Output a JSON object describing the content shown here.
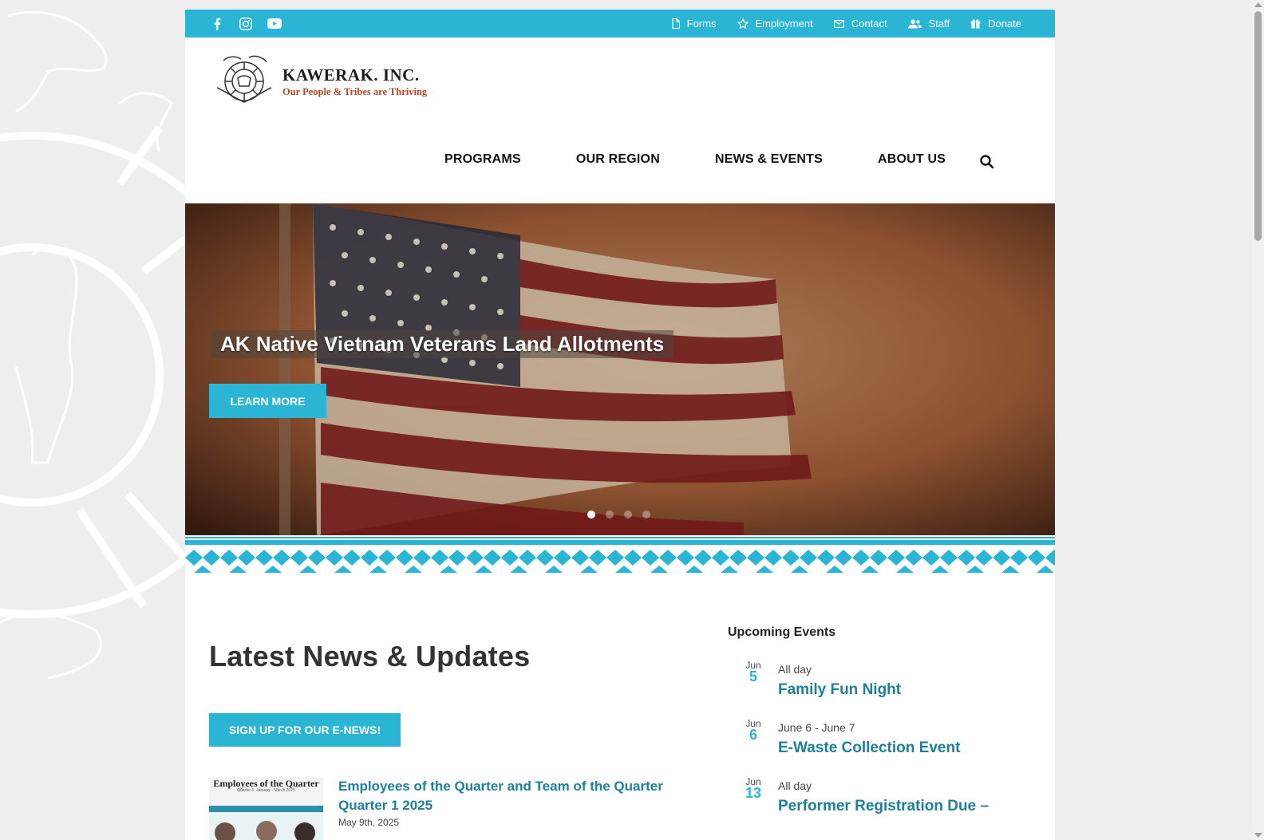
{
  "social": {
    "items": [
      {
        "icon": "facebook-icon"
      },
      {
        "icon": "instagram-icon"
      },
      {
        "icon": "youtube-icon"
      }
    ]
  },
  "utility_nav": {
    "items": [
      {
        "label": "Forms",
        "icon": "document-icon"
      },
      {
        "label": "Employment",
        "icon": "star-icon"
      },
      {
        "label": "Contact",
        "icon": "envelope-icon"
      },
      {
        "label": "Staff",
        "icon": "users-icon"
      },
      {
        "label": "Donate",
        "icon": "gift-icon"
      }
    ]
  },
  "logo": {
    "name": "KAWERAK. INC.",
    "tagline": "Our People & Tribes are Thriving"
  },
  "main_nav": {
    "items": [
      "PROGRAMS",
      "OUR REGION",
      "NEWS & EVENTS",
      "ABOUT US"
    ]
  },
  "hero": {
    "title": "AK Native Vietnam Veterans Land Allotments",
    "button": "LEARN MORE",
    "slides": 4,
    "active_slide": 1
  },
  "news": {
    "heading": "Latest News & Updates",
    "signup_button": "SIGN UP FOR OUR E-NEWS!",
    "items": [
      {
        "thumb_title": "Employees of the Quarter",
        "thumb_sub": "Quarter 1: January - March 2025",
        "title": "Employees of the Quarter and Team of the Quarter Quarter 1 2025",
        "date": "May 9th, 2025"
      }
    ]
  },
  "events": {
    "heading": "Upcoming Events",
    "items": [
      {
        "month": "Jun",
        "day": "5",
        "time": "All day",
        "title": "Family Fun Night"
      },
      {
        "month": "Jun",
        "day": "6",
        "time": "June 6 - June 7",
        "title": "E-Waste Collection Event"
      },
      {
        "month": "Jun",
        "day": "13",
        "time": "All day",
        "title": "Performer Registration Due –"
      }
    ]
  },
  "colors": {
    "accent": "#29b5d3",
    "link": "#1c7f9b",
    "tagline": "#c0461f"
  }
}
